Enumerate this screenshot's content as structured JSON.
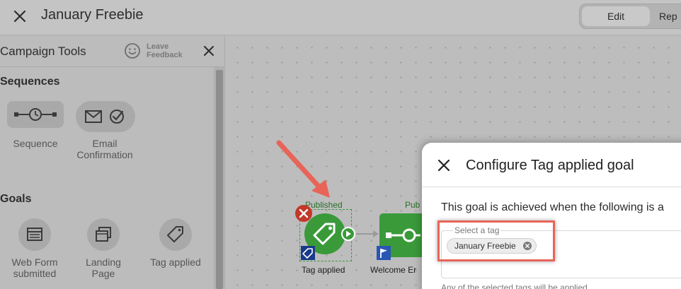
{
  "header": {
    "title": "January Freebie",
    "modes": {
      "edit": "Edit",
      "report": "Rep"
    }
  },
  "sidebar": {
    "title": "Campaign Tools",
    "feedback": {
      "line1": "Leave",
      "line2": "Feedback"
    },
    "sections": {
      "sequences": {
        "title": "Sequences",
        "items": [
          {
            "label": "Sequence",
            "icon": "sequence-clock-icon"
          },
          {
            "label_line1": "Email",
            "label_line2": "Confirmation",
            "icon": "email-check-icon"
          }
        ]
      },
      "goals": {
        "title": "Goals",
        "items": [
          {
            "label_line1": "Web Form",
            "label_line2": "submitted",
            "icon": "web-form-icon"
          },
          {
            "label_line1": "Landing",
            "label_line2": "Page",
            "icon": "landing-page-icon"
          },
          {
            "label": "Tag applied",
            "icon": "tag-icon"
          }
        ]
      }
    }
  },
  "canvas": {
    "nodes": [
      {
        "status": "Published",
        "name": "Tag applied",
        "icon": "tag-icon",
        "color": "#3a9a3a"
      },
      {
        "status": "Pub",
        "name": "Welcome Er",
        "icon": "sequence-icon",
        "color": "#3a9a3a"
      }
    ]
  },
  "modal": {
    "title": "Configure Tag applied goal",
    "description": "This goal is achieved when the following is a",
    "field_label": "Select a tag",
    "selected_tag": "January Freebie",
    "hint": "Any of the selected tags will be applied"
  },
  "colors": {
    "accent_green": "#3a9a3a",
    "error_red": "#c0392b",
    "annotation_red": "#e86458",
    "badge_blue": "#1a3a8a"
  }
}
